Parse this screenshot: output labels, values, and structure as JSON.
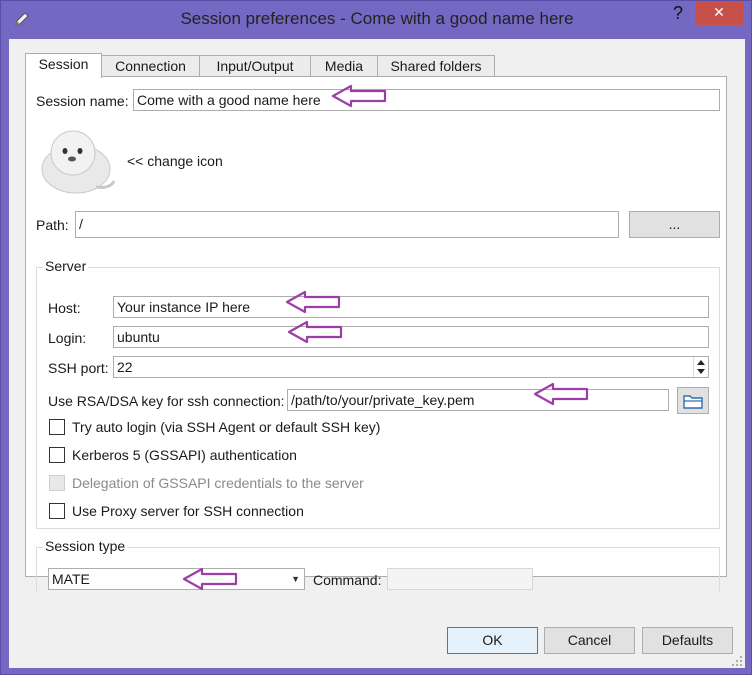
{
  "window": {
    "title": "Session preferences - Come with a good name here",
    "help_glyph": "?",
    "close_glyph": "✕"
  },
  "tabs": [
    {
      "label": "Session",
      "active": true
    },
    {
      "label": "Connection",
      "active": false
    },
    {
      "label": "Input/Output",
      "active": false
    },
    {
      "label": "Media",
      "active": false
    },
    {
      "label": "Shared folders",
      "active": false
    }
  ],
  "session": {
    "name_label": "Session name:",
    "name_value": "Come with a good name here",
    "change_icon_label": "<< change icon",
    "path_label": "Path:",
    "path_value": "/",
    "browse_label": "..."
  },
  "server": {
    "title": "Server",
    "host_label": "Host:",
    "host_value": "Your instance IP here",
    "login_label": "Login:",
    "login_value": "ubuntu",
    "ssh_port_label": "SSH port:",
    "ssh_port_value": "22",
    "key_label": "Use RSA/DSA key for ssh connection:",
    "key_value": "/path/to/your/private_key.pem",
    "options": [
      {
        "label": "Try auto login (via SSH Agent or default SSH key)",
        "checked": false,
        "enabled": true
      },
      {
        "label": "Kerberos 5 (GSSAPI) authentication",
        "checked": false,
        "enabled": true
      },
      {
        "label": "Delegation of GSSAPI credentials to the server",
        "checked": false,
        "enabled": false
      },
      {
        "label": "Use Proxy server for SSH connection",
        "checked": false,
        "enabled": true
      }
    ]
  },
  "session_type": {
    "title": "Session type",
    "selected": "MATE",
    "command_label": "Command:",
    "command_value": ""
  },
  "footer": {
    "ok_label": "OK",
    "cancel_label": "Cancel",
    "defaults_label": "Defaults"
  },
  "colors": {
    "window_frame": "#7468c2",
    "annotation_arrow": "#9b3fa6",
    "close_button": "#c7504a"
  }
}
